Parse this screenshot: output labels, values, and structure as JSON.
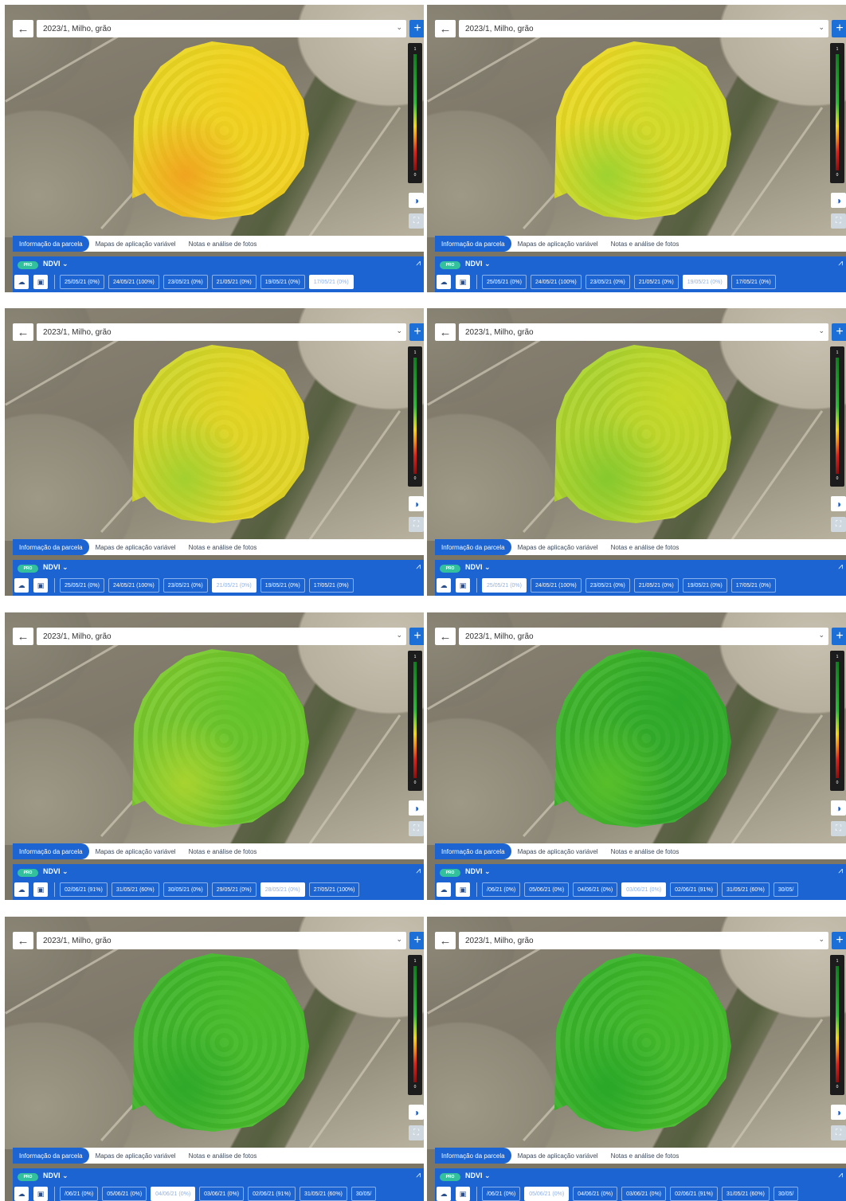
{
  "common": {
    "back_icon": "arrow-left-icon",
    "season": "2023/1, Milho, grão",
    "select_chevron": "⌄",
    "add_label": "+",
    "legend": {
      "max": "1",
      "min": "0"
    },
    "contrast_icon": "◑",
    "fullscreen_icon": "⛶",
    "tabs": [
      "Informação da parcela",
      "Mapas de aplicação variável",
      "Notas e análise de fotos"
    ],
    "active_tab": 0,
    "pro_badge": "PRO",
    "index": "NDVI",
    "index_chevron": "⌄",
    "chart_icon": "⩘",
    "cloud_icon": "☁",
    "calendar_icon": "▣"
  },
  "colors": {
    "accent": "#1c64d2",
    "pro": "#33c19d"
  },
  "panels": [
    {
      "field_colors": [
        "#e9d822",
        "#f2cf1f",
        "#f0a41f"
      ],
      "dates": [
        "25/05/21 (0%)",
        "24/05/21 (100%)",
        "23/05/21 (0%)",
        "21/05/21 (0%)",
        "19/05/21 (0%)",
        "17/05/21 (0%)"
      ],
      "active_date": 5
    },
    {
      "field_colors": [
        "#f0d822",
        "#cbdb2a",
        "#9ed230"
      ],
      "dates": [
        "25/05/21 (0%)",
        "24/05/21 (100%)",
        "23/05/21 (0%)",
        "21/05/21 (0%)",
        "19/05/21 (0%)",
        "17/05/21 (0%)"
      ],
      "active_date": 4
    },
    {
      "field_colors": [
        "#ccd72a",
        "#e6d423",
        "#a3d02f"
      ],
      "dates": [
        "25/05/21 (0%)",
        "24/05/21 (100%)",
        "23/05/21 (0%)",
        "21/05/21 (0%)",
        "19/05/21 (0%)",
        "17/05/21 (0%)"
      ],
      "active_date": 3
    },
    {
      "field_colors": [
        "#a5d22f",
        "#c8d929",
        "#86c92e"
      ],
      "dates": [
        "25/05/21 (0%)",
        "24/05/21 (100%)",
        "23/05/21 (0%)",
        "21/05/21 (0%)",
        "19/05/21 (0%)",
        "17/05/21 (0%)"
      ],
      "active_date": 0
    },
    {
      "field_colors": [
        "#7fca2e",
        "#62c32a",
        "#a8d32f"
      ],
      "dates": [
        "02/06/21 (91%)",
        "31/05/21 (60%)",
        "30/05/21 (0%)",
        "29/05/21 (0%)",
        "28/05/21 (0%)",
        "27/05/21 (100%)"
      ],
      "active_date": 4
    },
    {
      "field_colors": [
        "#3fb52a",
        "#2ea82a",
        "#58bf2a"
      ],
      "dates": [
        "/06/21 (0%)",
        "05/06/21 (0%)",
        "04/06/21 (0%)",
        "03/06/21 (0%)",
        "02/06/21 (91%)",
        "31/05/21 (60%)",
        "30/05/"
      ],
      "active_date": 3
    },
    {
      "field_colors": [
        "#3cb42a",
        "#4bbd2c",
        "#2fa829"
      ],
      "dates": [
        "/06/21 (0%)",
        "05/06/21 (0%)",
        "04/06/21 (0%)",
        "03/06/21 (0%)",
        "02/06/21 (91%)",
        "31/05/21 (60%)",
        "30/05/"
      ],
      "active_date": 2
    },
    {
      "field_colors": [
        "#35b22a",
        "#46bb2b",
        "#2aa728"
      ],
      "dates": [
        "/06/21 (0%)",
        "05/06/21 (0%)",
        "04/06/21 (0%)",
        "03/06/21 (0%)",
        "02/06/21 (91%)",
        "31/05/21 (60%)",
        "30/05/"
      ],
      "active_date": 1
    }
  ]
}
